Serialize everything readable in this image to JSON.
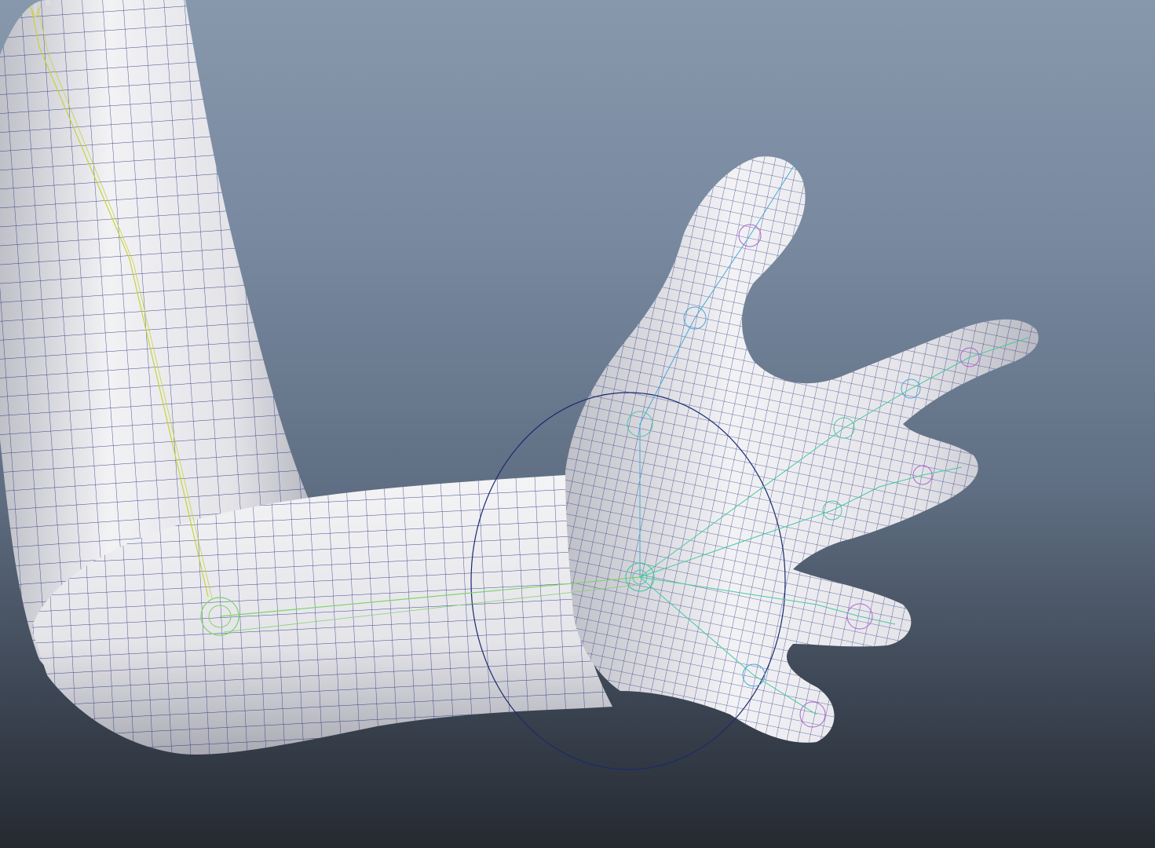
{
  "app": {
    "view": "viewport-perspective"
  },
  "hud": {
    "axis_readout": "0"
  },
  "colors": {
    "background_top": "#8798ac",
    "background_bottom": "#252a31",
    "mesh_fill": "#ececf0",
    "wire": "#1f2a7a",
    "bone_arm": "#c9d23a",
    "bone_forearm": "#7fd36a",
    "bone_hand": "#48c9a0",
    "bone_finger": "#4aa8d8",
    "bone_tip": "#b063d0",
    "control_circle": "#1b2a6e"
  },
  "icons": {
    "axis_gizmo": "axis-gizmo-icon"
  }
}
